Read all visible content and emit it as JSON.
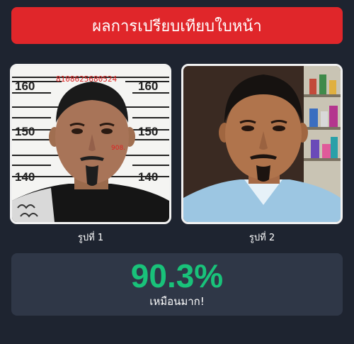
{
  "header": {
    "title": "ผลการเปรียบเทียบใบหน้า",
    "background": "#e0262a"
  },
  "photos": [
    {
      "caption": "รูปที่ 1",
      "height_marks": [
        "160",
        "160",
        "150",
        "150",
        "140",
        "140"
      ],
      "stamp_number": "8108625680524",
      "stamp_small": "908."
    },
    {
      "caption": "รูปที่ 2"
    }
  ],
  "result": {
    "score": "90.3%",
    "verdict": "เหมือนมาก!",
    "score_color": "#19c27a"
  }
}
